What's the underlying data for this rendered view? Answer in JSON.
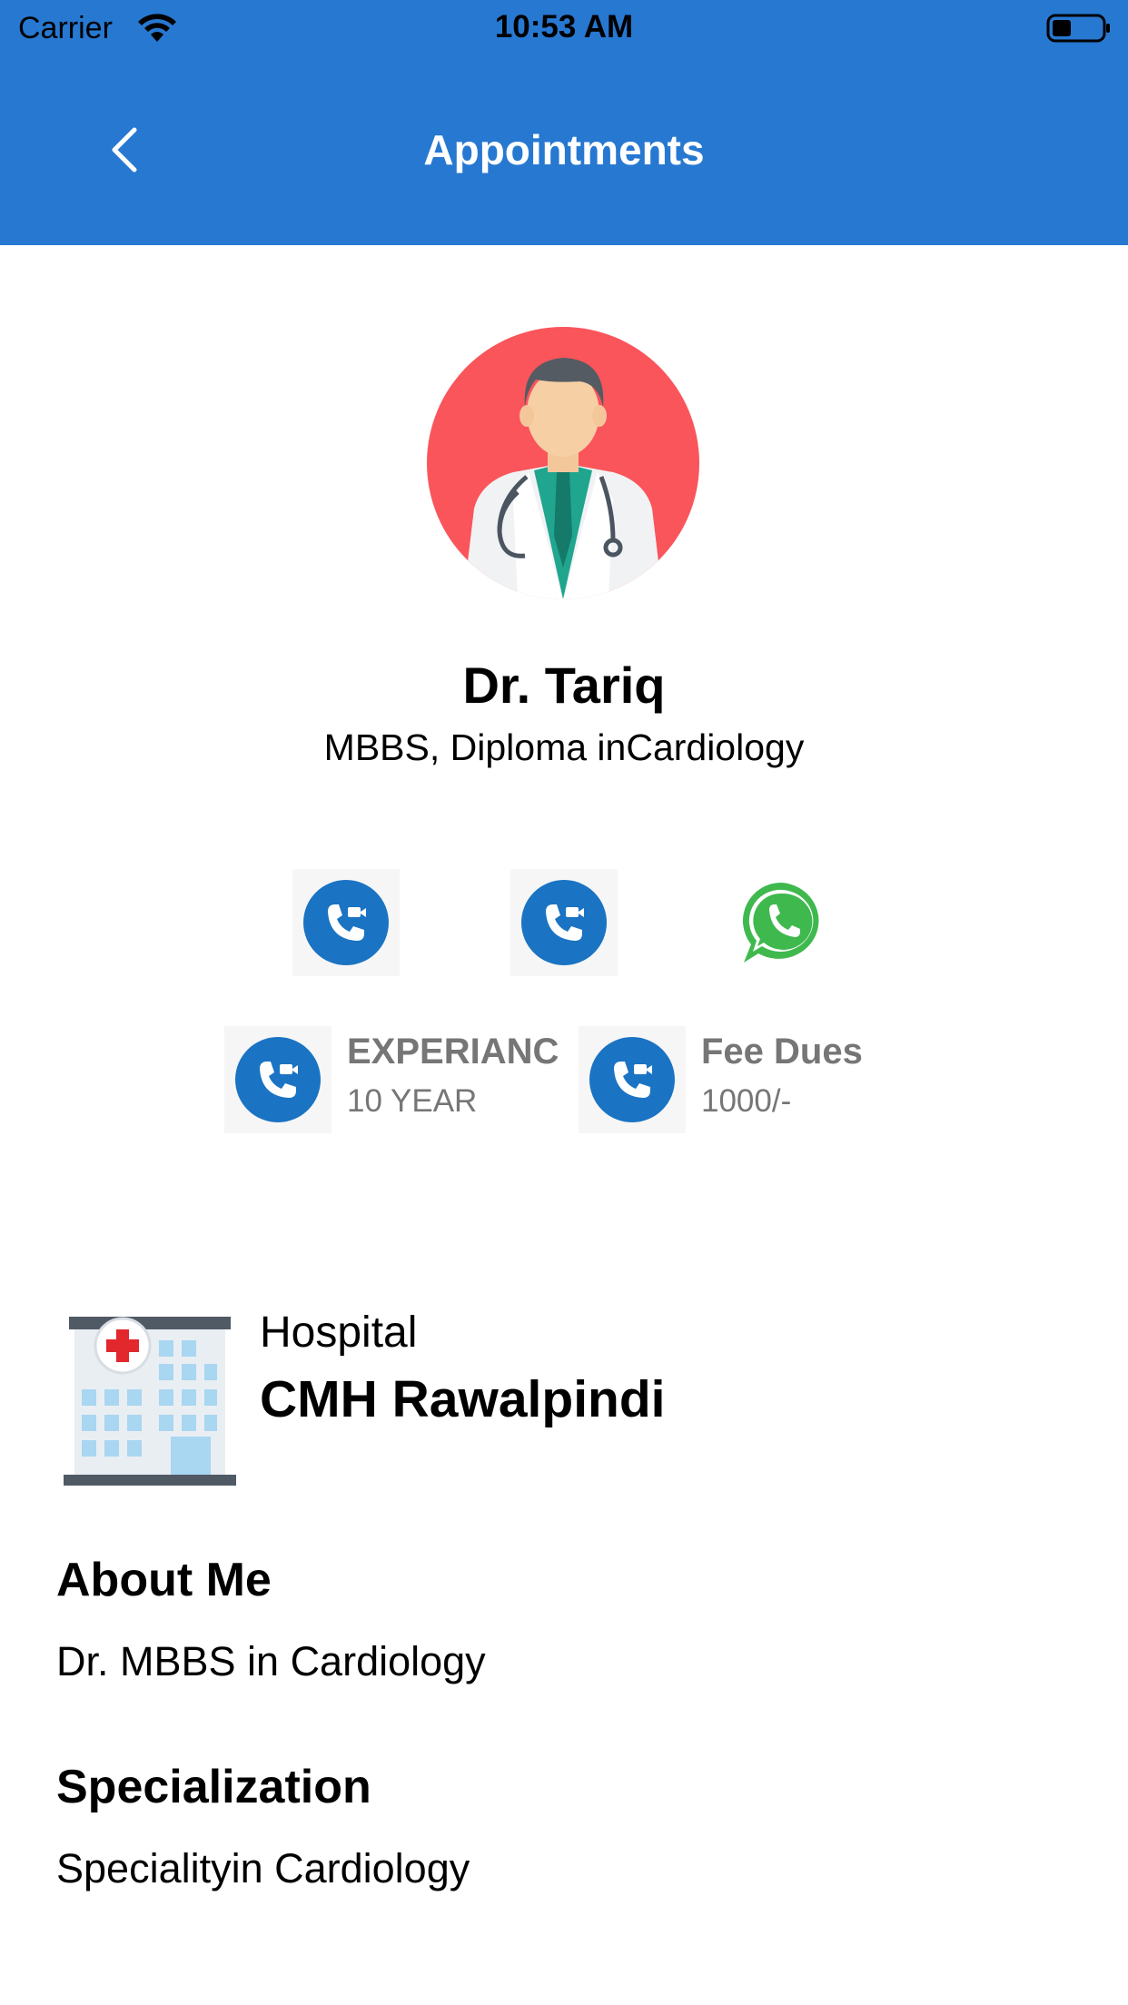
{
  "status_bar": {
    "carrier": "Carrier",
    "time": "10:53 AM"
  },
  "nav": {
    "title": "Appointments",
    "back_icon": "chevron-left-icon"
  },
  "doctor": {
    "name": "Dr. Tariq",
    "qualifications": "MBBS, Diploma inCardiology",
    "avatar_icon": "doctor-avatar-icon"
  },
  "actions": [
    {
      "icon": "video-call-icon"
    },
    {
      "icon": "video-call-icon"
    },
    {
      "icon": "whatsapp-icon"
    }
  ],
  "info": {
    "experience": {
      "title": "EXPERIANC",
      "value": "10 YEAR"
    },
    "fee": {
      "title": "Fee Dues",
      "value": "1000/-"
    }
  },
  "hospital": {
    "label": "Hospital",
    "name": "CMH Rawalpindi"
  },
  "about": {
    "heading": "About Me",
    "text": "Dr. MBBS in Cardiology"
  },
  "specialization": {
    "heading": "Specialization",
    "text": "Specialityin Cardiology"
  },
  "colors": {
    "header": "#2778d1",
    "call_icon": "#1a73c3",
    "whatsapp": "#3fb94e",
    "avatar_bg": "#f9555b",
    "info_text": "#767676"
  }
}
